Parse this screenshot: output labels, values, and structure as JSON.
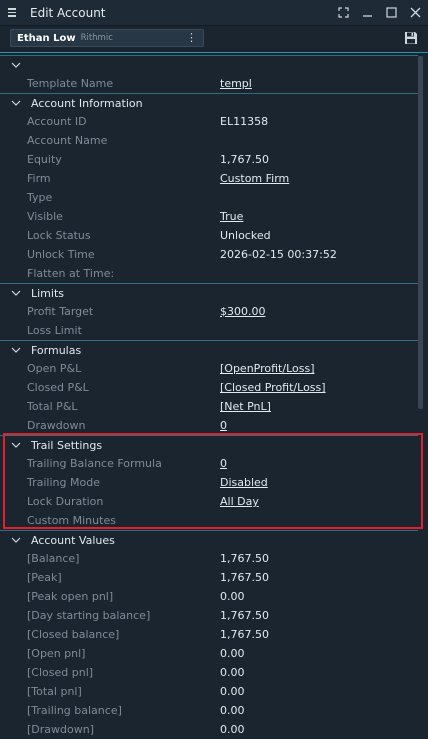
{
  "window": {
    "title": "Edit Account",
    "controls": [
      "expand-icon",
      "minimize-icon",
      "maximize-icon",
      "close-icon"
    ]
  },
  "account": {
    "name": "Ethan Low",
    "connection": "Rithmic"
  },
  "rows": [
    {
      "kind": "hdr",
      "label": "",
      "chev": true
    },
    {
      "kind": "item",
      "label": "Template Name",
      "value": "templ",
      "link": true
    },
    {
      "kind": "hdr",
      "label": "Account Information"
    },
    {
      "kind": "item",
      "label": "Account ID",
      "value": "EL11358",
      "link": false
    },
    {
      "kind": "item",
      "label": "Account Name",
      "value": "",
      "link": false
    },
    {
      "kind": "item",
      "label": "Equity",
      "value": "1,767.50",
      "link": false
    },
    {
      "kind": "item",
      "label": "Firm",
      "value": "Custom Firm",
      "link": true
    },
    {
      "kind": "item",
      "label": "Type",
      "value": "",
      "link": false
    },
    {
      "kind": "item",
      "label": "Visible",
      "value": "True",
      "link": true
    },
    {
      "kind": "item",
      "label": "Lock Status",
      "value": "Unlocked",
      "link": false
    },
    {
      "kind": "item",
      "label": "Unlock Time",
      "value": "2026-02-15 00:37:52",
      "link": false
    },
    {
      "kind": "item",
      "label": "Flatten at Time:",
      "value": "",
      "link": false
    },
    {
      "kind": "hdr",
      "label": "Limits"
    },
    {
      "kind": "item",
      "label": "Profit Target",
      "value": "$300.00",
      "link": true
    },
    {
      "kind": "item",
      "label": "Loss Limit",
      "value": "",
      "link": false
    },
    {
      "kind": "hdr",
      "label": "Formulas"
    },
    {
      "kind": "item",
      "label": "Open P&L",
      "value": "[OpenProfit/Loss]",
      "link": true
    },
    {
      "kind": "item",
      "label": "Closed P&L",
      "value": "[Closed Profit/Loss]",
      "link": true
    },
    {
      "kind": "item",
      "label": "Total P&L",
      "value": "[Net PnL]",
      "link": true
    },
    {
      "kind": "item",
      "label": "Drawdown",
      "value": "0",
      "link": true
    },
    {
      "kind": "hdr",
      "label": "Trail Settings"
    },
    {
      "kind": "item",
      "label": "Trailing Balance Formula",
      "value": "0",
      "link": true
    },
    {
      "kind": "item",
      "label": "Trailing Mode",
      "value": "Disabled",
      "link": true
    },
    {
      "kind": "item",
      "label": "Lock Duration",
      "value": "All Day",
      "link": true
    },
    {
      "kind": "item",
      "label": "Custom Minutes",
      "value": "",
      "link": false
    },
    {
      "kind": "hdr",
      "label": "Account Values"
    },
    {
      "kind": "item",
      "label": "[Balance]",
      "value": "1,767.50",
      "link": false
    },
    {
      "kind": "item",
      "label": "[Peak]",
      "value": "1,767.50",
      "link": false
    },
    {
      "kind": "item",
      "label": "[Peak open pnl]",
      "value": "0.00",
      "link": false
    },
    {
      "kind": "item",
      "label": "[Day starting balance]",
      "value": "1,767.50",
      "link": false
    },
    {
      "kind": "item",
      "label": "[Closed balance]",
      "value": "1,767.50",
      "link": false
    },
    {
      "kind": "item",
      "label": "[Open pnl]",
      "value": "0.00",
      "link": false
    },
    {
      "kind": "item",
      "label": "[Closed pnl]",
      "value": "0.00",
      "link": false
    },
    {
      "kind": "item",
      "label": "[Total pnl]",
      "value": "0.00",
      "link": false
    },
    {
      "kind": "item",
      "label": "[Trailing balance]",
      "value": "0.00",
      "link": false
    },
    {
      "kind": "item",
      "label": "[Drawdown]",
      "value": "0.00",
      "link": false
    }
  ],
  "colors": {
    "highlight": "#e0202a",
    "accent": "#2f8fa5",
    "background": "#1a2530"
  }
}
